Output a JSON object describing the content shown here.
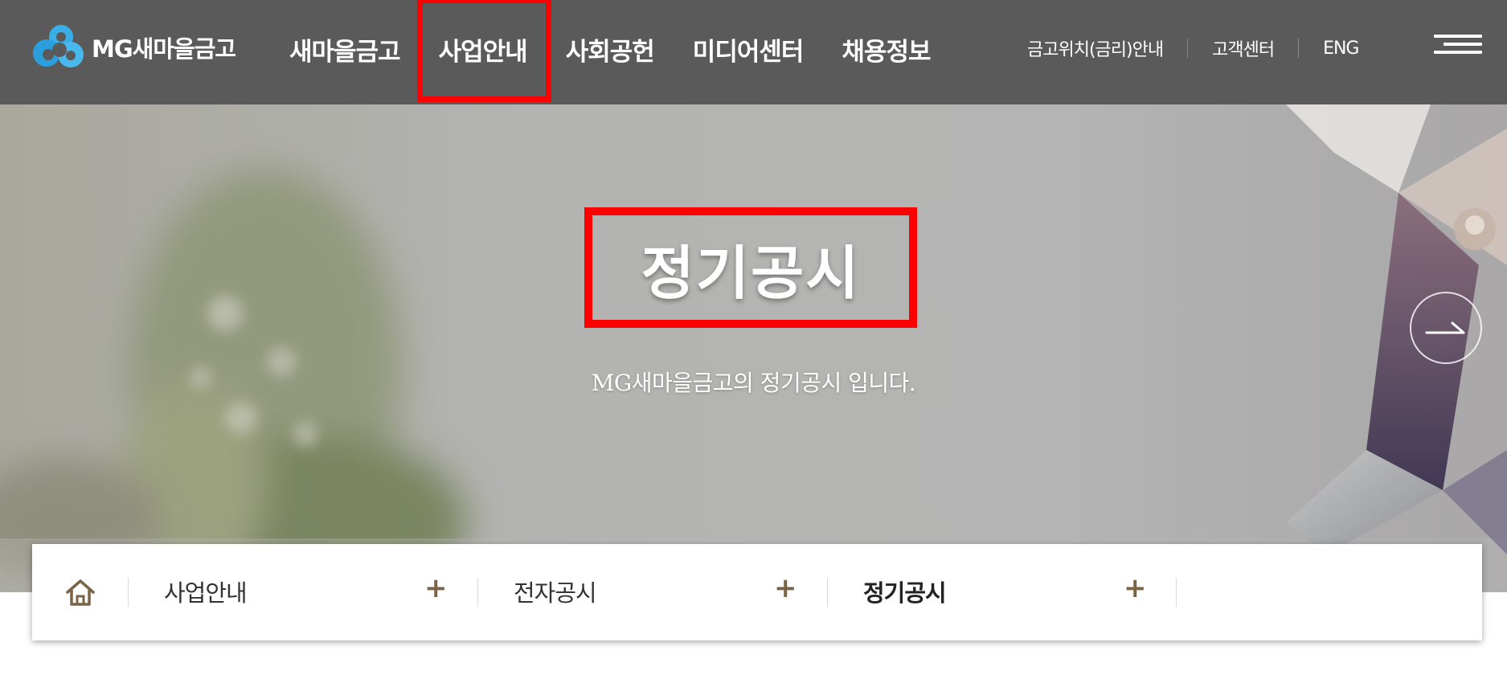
{
  "header": {
    "logo_text": "MG새마을금고",
    "gnb": [
      "새마을금고",
      "사업안내",
      "사회공헌",
      "미디어센터",
      "채용정보"
    ],
    "util": [
      "금고위치(금리)안내",
      "고객센터",
      "ENG"
    ],
    "menu_icon": "hamburger-menu-icon"
  },
  "hero": {
    "title": "정기공시",
    "subtitle": "MG새마을금고의 정기공시 입니다.",
    "next_icon": "arrow-right-icon"
  },
  "breadcrumb": {
    "home_icon": "home-icon",
    "items": [
      {
        "label": "사업안내",
        "toggle": "+"
      },
      {
        "label": "전자공시",
        "toggle": "+"
      },
      {
        "label": "정기공시",
        "toggle": "+"
      }
    ]
  },
  "colors": {
    "header_bg": "#5a5a5a",
    "highlight": "#ff0000",
    "accent": "#7b6346",
    "logo_blue": "#2aa3e0"
  }
}
